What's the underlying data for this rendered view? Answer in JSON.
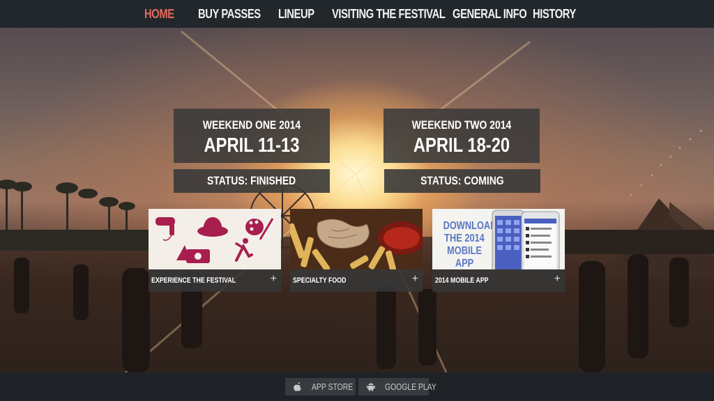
{
  "nav": {
    "items": [
      {
        "label": "HOME"
      },
      {
        "label": "BUY PASSES"
      },
      {
        "label": "LINEUP"
      },
      {
        "label": "VISITING THE FESTIVAL"
      },
      {
        "label": "GENERAL INFO"
      },
      {
        "label": "HISTORY"
      }
    ],
    "active_color": "#e06a5a"
  },
  "weekends": [
    {
      "title": "WEEKEND ONE 2014",
      "dates": "APRIL 11-13",
      "status": "STATUS: FINISHED"
    },
    {
      "title": "WEEKEND TWO 2014",
      "dates": "APRIL 18-20",
      "status": "STATUS: COMING"
    }
  ],
  "cards": [
    {
      "caption": "EXPERIENCE THE FESTIVAL",
      "plus": "+",
      "icon_color": "#a81e4f",
      "icons": [
        "hair-dryer-icon",
        "hat-icon",
        "palette-icon",
        "camera-icon",
        "yoga-icon"
      ]
    },
    {
      "caption": "SPECIALTY FOOD",
      "plus": "+"
    },
    {
      "caption": "2014 MOBILE APP",
      "plus": "+",
      "promo": [
        "DOWNLOAD",
        "THE 2014",
        "MOBILE APP"
      ],
      "promo_color": "#5b77c4"
    }
  ],
  "footer": {
    "buttons": [
      {
        "label": "APP STORE",
        "icon": "apple-icon"
      },
      {
        "label": "GOOGLE PLAY",
        "icon": "android-icon"
      }
    ]
  }
}
